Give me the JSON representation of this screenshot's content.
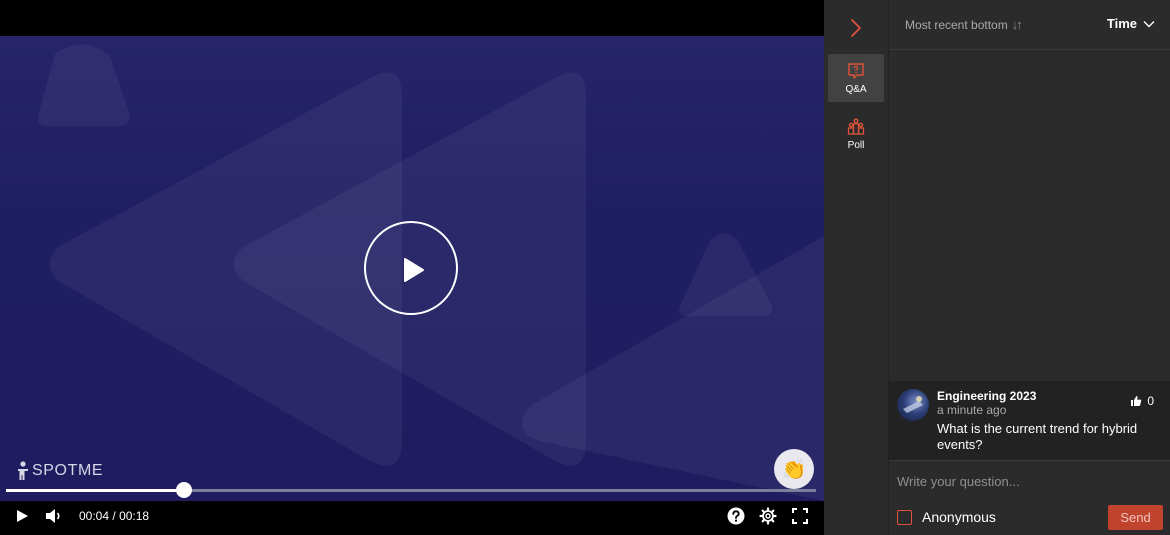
{
  "video": {
    "logo_text": "SPOTME",
    "elapsed": "00:04",
    "separator": "/",
    "duration": "00:18",
    "progress_fraction": 0.22,
    "clap_emoji": "👏",
    "icons": [
      "play-icon",
      "volume-icon",
      "help-icon",
      "settings-icon",
      "fullscreen-icon"
    ]
  },
  "rail": {
    "tabs": [
      {
        "label": "Q&A",
        "icon": "qa-icon",
        "active": true
      },
      {
        "label": "Poll",
        "icon": "poll-icon",
        "active": false
      }
    ],
    "accent": "#e0523a"
  },
  "panel": {
    "sort_label": "Most recent bottom",
    "sort_arrows": "↓↑",
    "time_label": "Time",
    "questions": [
      {
        "author": "Engineering 2023",
        "time": "a minute ago",
        "text": "What is the current trend for hybrid events?",
        "likes": "0"
      }
    ],
    "input_placeholder": "Write your question...",
    "anonymous_label": "Anonymous",
    "send_label": "Send"
  }
}
